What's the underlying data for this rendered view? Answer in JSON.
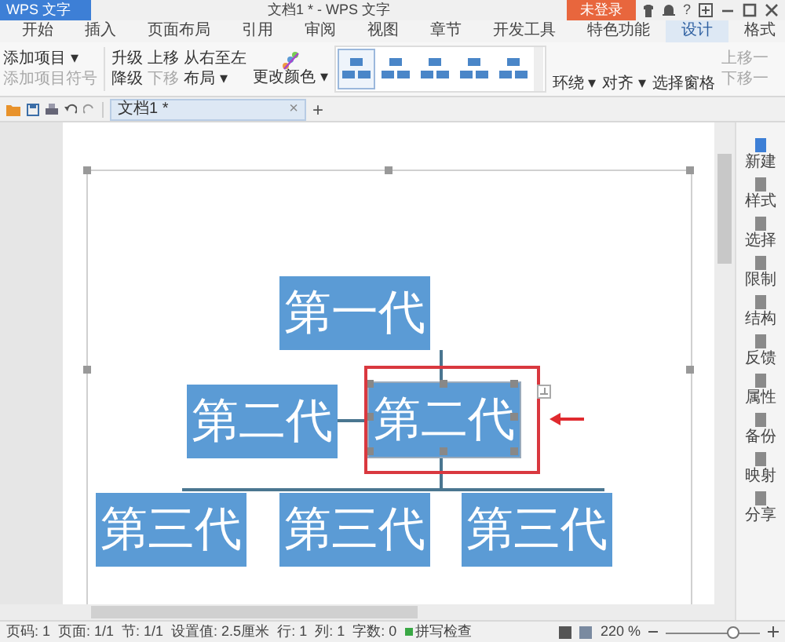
{
  "app": {
    "logo": "WPS 文字",
    "title": "文档1 * - WPS 文字",
    "login": "未登录",
    "help": "?"
  },
  "menu_tabs": [
    {
      "label": "开始",
      "selected": false
    },
    {
      "label": "插入",
      "selected": false
    },
    {
      "label": "页面布局",
      "selected": false
    },
    {
      "label": "引用",
      "selected": false
    },
    {
      "label": "审阅",
      "selected": false
    },
    {
      "label": "视图",
      "selected": false
    },
    {
      "label": "章节",
      "selected": false
    },
    {
      "label": "开发工具",
      "selected": false
    },
    {
      "label": "特色功能",
      "selected": false
    },
    {
      "label": "设计",
      "selected": true
    },
    {
      "label": "格式",
      "selected": false
    }
  ],
  "ribbon": {
    "col1": [
      {
        "label": "添加项目 ▾",
        "disabled": false
      },
      {
        "label": "添加项目符号",
        "disabled": true
      }
    ],
    "col2": [
      {
        "label": "升级",
        "disabled": false
      },
      {
        "label": "上移",
        "disabled": false
      },
      {
        "label": "从右至左",
        "disabled": false
      },
      {
        "label": "降级",
        "disabled": false
      },
      {
        "label": "下移",
        "disabled": true
      },
      {
        "label": "布局 ▾",
        "disabled": false
      }
    ],
    "color_button": "更改颜色 ▾",
    "styles": [
      {
        "selected": true
      },
      {
        "selected": false
      },
      {
        "selected": false
      },
      {
        "selected": false
      },
      {
        "selected": false
      }
    ],
    "right": [
      {
        "label": "环绕 ▾",
        "disabled": false
      },
      {
        "label": "对齐 ▾",
        "disabled": false
      },
      {
        "label": "选择窗格",
        "disabled": false
      }
    ],
    "move": [
      {
        "label": "上移一",
        "disabled": true
      },
      {
        "label": "下移一",
        "disabled": true
      }
    ]
  },
  "doc_tab": {
    "label": "文档1 *",
    "close": "×",
    "add": "+"
  },
  "diagram": {
    "rows": [
      [
        {
          "text": "第一代",
          "selected": false
        }
      ],
      [
        {
          "text": "第二代",
          "selected": false
        },
        {
          "text": "第二代",
          "selected": true
        }
      ],
      [
        {
          "text": "第三代",
          "selected": false
        },
        {
          "text": "第三代",
          "selected": false
        },
        {
          "text": "第三代",
          "selected": false
        }
      ]
    ]
  },
  "sidebar": [
    "新建",
    "样式",
    "选择",
    "限制",
    "结构",
    "反馈",
    "属性",
    "备份",
    "映射",
    "分享"
  ],
  "status_bar": {
    "items": [
      "页码: 1",
      "页面: 1/1",
      "节: 1/1",
      "设置值: 2.5厘米",
      "行: 1",
      "列: 1",
      "字数: 0"
    ],
    "spell_check": {
      "label": "拼写检查",
      "on": true
    },
    "zoom": "220 %",
    "zoom_level": {
      "level": 0.72
    }
  }
}
